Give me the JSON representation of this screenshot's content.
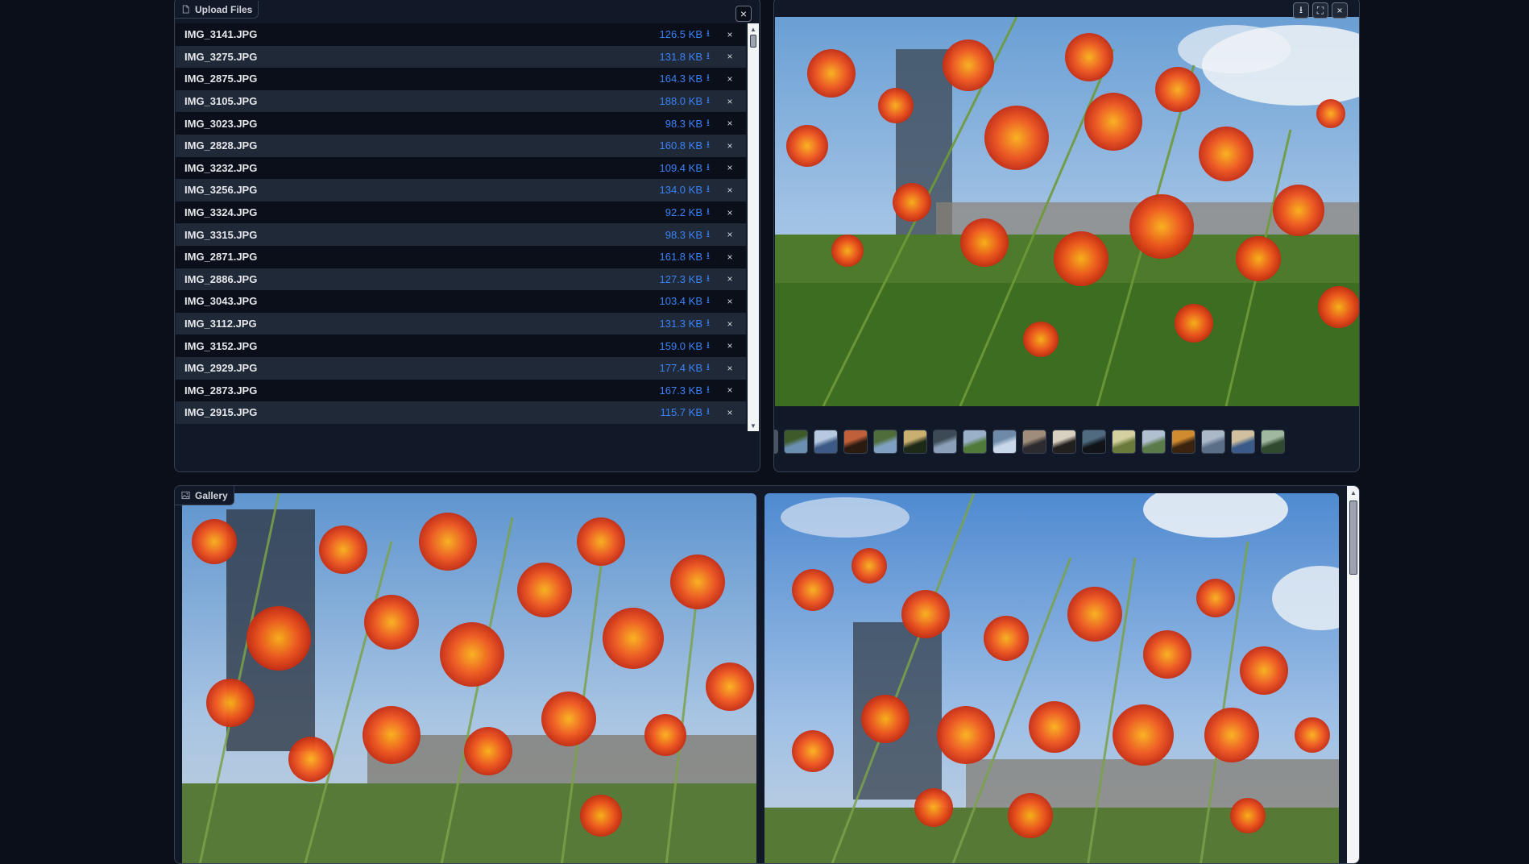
{
  "upload": {
    "label": "Upload Files",
    "label_icon": "file-icon",
    "close_label": "×",
    "remove_label": "×",
    "download_glyph": "⭳",
    "files": [
      {
        "name": "IMG_3141.JPG",
        "size": "126.5 KB"
      },
      {
        "name": "IMG_3275.JPG",
        "size": "131.8 KB"
      },
      {
        "name": "IMG_2875.JPG",
        "size": "164.3 KB"
      },
      {
        "name": "IMG_3105.JPG",
        "size": "188.0 KB"
      },
      {
        "name": "IMG_3023.JPG",
        "size": "98.3 KB"
      },
      {
        "name": "IMG_2828.JPG",
        "size": "160.8 KB"
      },
      {
        "name": "IMG_3232.JPG",
        "size": "109.4 KB"
      },
      {
        "name": "IMG_3256.JPG",
        "size": "134.0 KB"
      },
      {
        "name": "IMG_3324.JPG",
        "size": "92.2 KB"
      },
      {
        "name": "IMG_3315.JPG",
        "size": "98.3 KB"
      },
      {
        "name": "IMG_2871.JPG",
        "size": "161.8 KB"
      },
      {
        "name": "IMG_2886.JPG",
        "size": "127.3 KB"
      },
      {
        "name": "IMG_3043.JPG",
        "size": "103.4 KB"
      },
      {
        "name": "IMG_3112.JPG",
        "size": "131.3 KB"
      },
      {
        "name": "IMG_3152.JPG",
        "size": "159.0 KB"
      },
      {
        "name": "IMG_2929.JPG",
        "size": "177.4 KB"
      },
      {
        "name": "IMG_2873.JPG",
        "size": "167.3 KB"
      },
      {
        "name": "IMG_2915.JPG",
        "size": "115.7 KB"
      }
    ]
  },
  "preview": {
    "buttons": [
      {
        "icon": "download-icon",
        "glyph": "⭳"
      },
      {
        "icon": "fullscreen-icon",
        "glyph": "⛶"
      },
      {
        "icon": "close-icon",
        "glyph": "×"
      }
    ],
    "thumbnail_count": 17
  },
  "gallery": {
    "label": "Gallery",
    "label_icon": "image-icon"
  },
  "colors": {
    "background": "#0b0f19",
    "panel": "#111827",
    "accent_link": "#3b82f6",
    "border": "#374151"
  }
}
